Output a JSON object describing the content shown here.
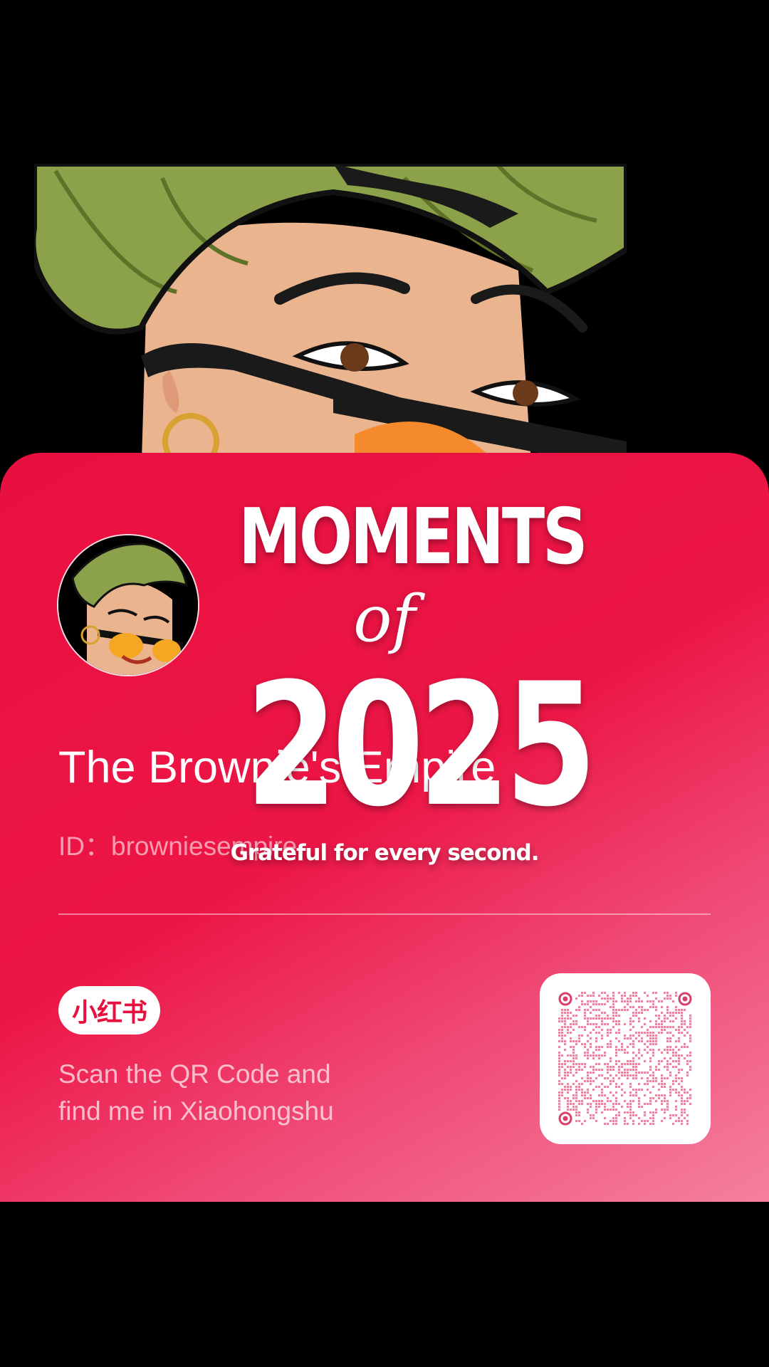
{
  "profile": {
    "display_name": "The Brownie's Empire",
    "id_text": "ID：browniesempire"
  },
  "brand": {
    "logo_text": "小红书"
  },
  "share": {
    "scan_line1": "Scan the QR Code and",
    "scan_line2": "find me in Xiaohongshu"
  },
  "sticker": {
    "line1": "MOMENTS",
    "line2": "of",
    "line3": "2025",
    "tagline": "Grateful for every second."
  },
  "colors": {
    "accent": "#e8103f",
    "turban": "#8ca24a",
    "skin": "#eab48f"
  },
  "icons": {
    "avatar": "bitmoji-avatar",
    "qr": "qr-code-icon"
  }
}
